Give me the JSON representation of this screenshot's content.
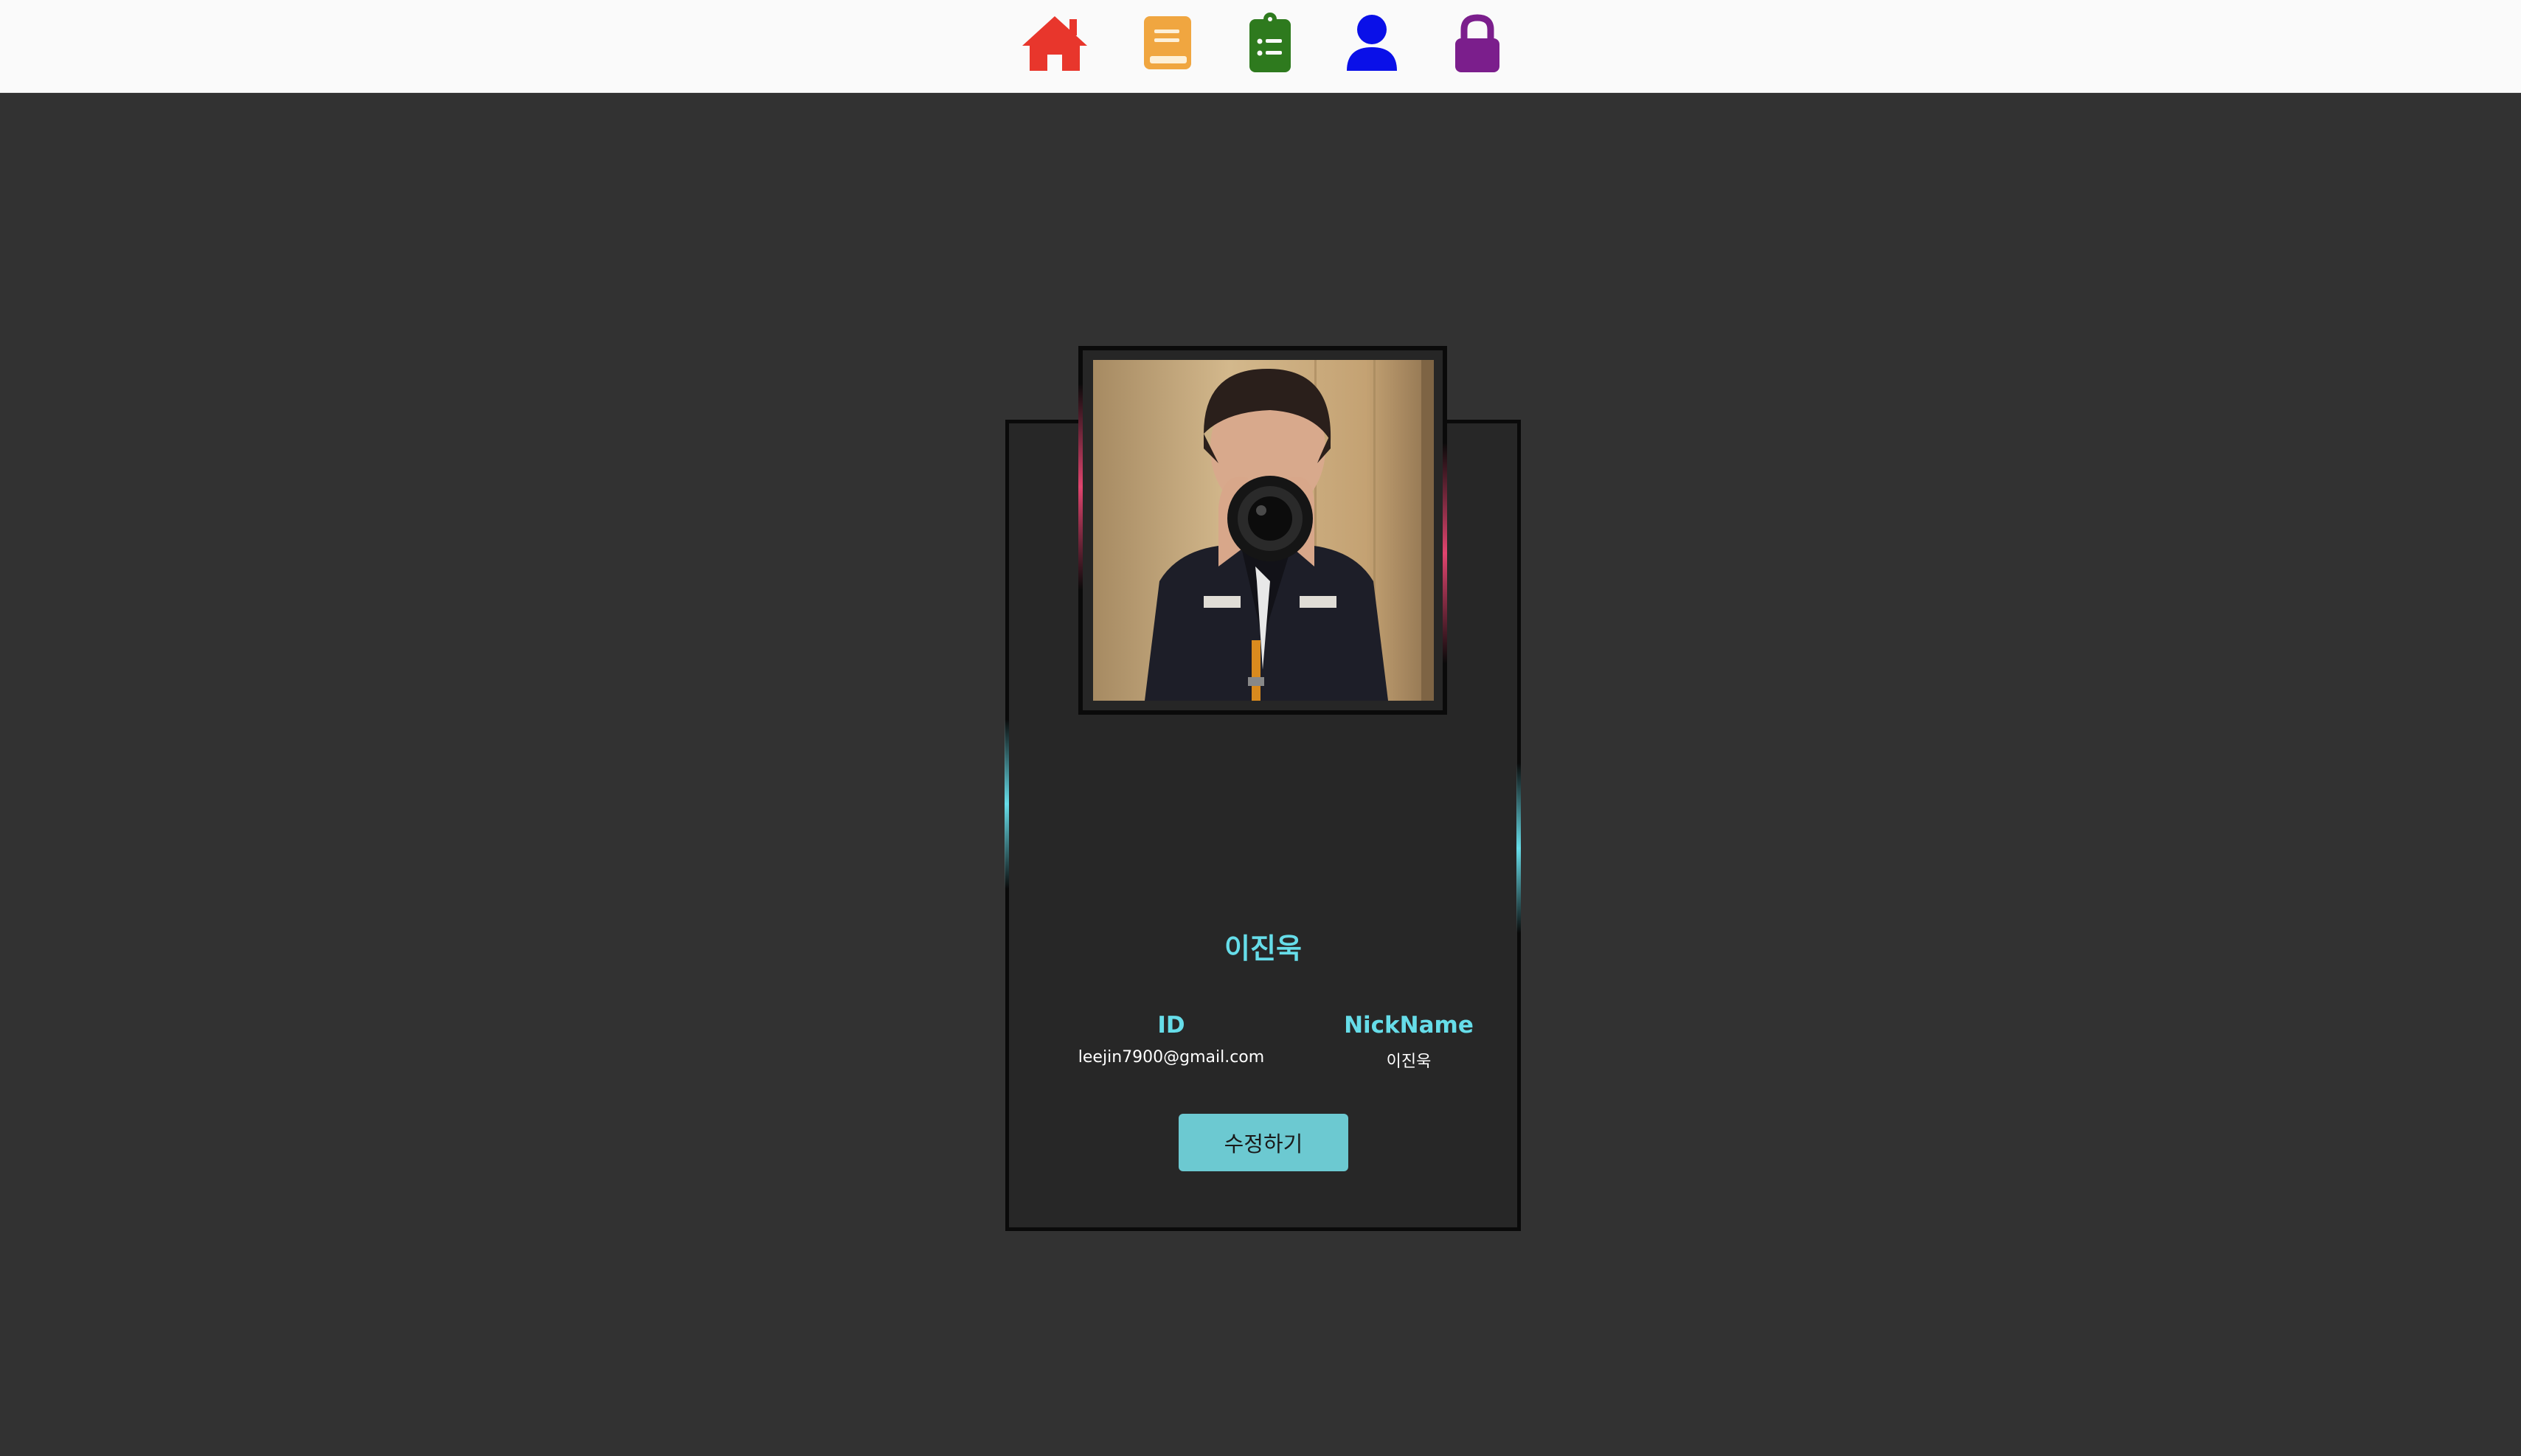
{
  "nav": {
    "items": [
      {
        "icon": "home-icon",
        "color": "#e8362c"
      },
      {
        "icon": "book-icon",
        "color": "#f0a640"
      },
      {
        "icon": "clipboard-list-icon",
        "color": "#2e7a1e"
      },
      {
        "icon": "user-icon",
        "color": "#0a10e8"
      },
      {
        "icon": "lock-icon",
        "color": "#7b1e8c"
      }
    ]
  },
  "profile": {
    "name": "이진욱",
    "id_label": "ID",
    "id_value": "leejin7900@gmail.com",
    "nickname_label": "NickName",
    "nickname_value": "이진욱",
    "edit_button_label": "수정하기"
  },
  "colors": {
    "background": "#323232",
    "card": "#272727",
    "accent_cyan": "#66dde9",
    "accent_pink": "#e0446e",
    "button": "#6cc9d1"
  }
}
